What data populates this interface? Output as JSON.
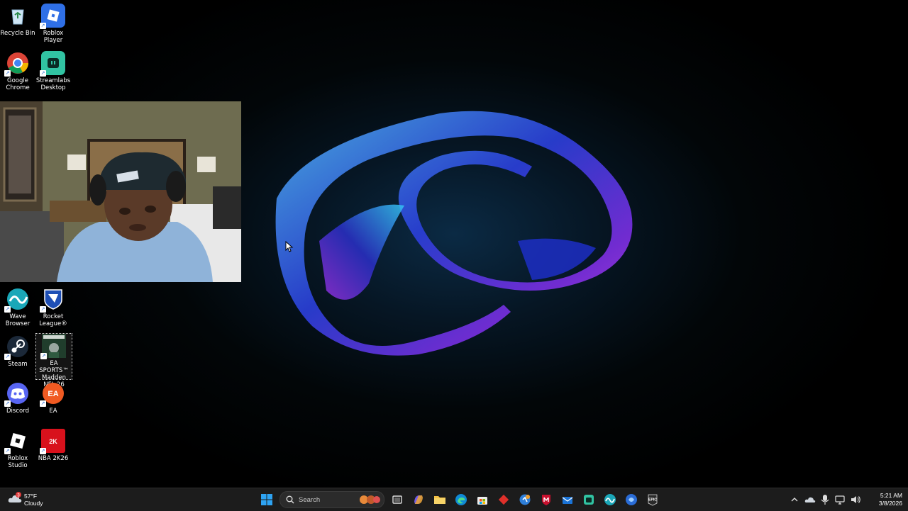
{
  "desktop": {
    "icons": [
      {
        "label": "Recycle Bin",
        "icon": "recycle-bin-icon"
      },
      {
        "label": "Roblox Player",
        "icon": "roblox-icon"
      },
      {
        "label": "Google Chrome",
        "icon": "chrome-icon"
      },
      {
        "label": "Streamlabs Desktop",
        "icon": "streamlabs-icon"
      },
      {
        "label": "Wave Browser",
        "icon": "wave-browser-icon"
      },
      {
        "label": "Rocket League®",
        "icon": "rocket-league-icon"
      },
      {
        "label": "Steam",
        "icon": "steam-icon"
      },
      {
        "label": "EA SPORTS™ Madden NFL 26",
        "icon": "madden-icon"
      },
      {
        "label": "Discord",
        "icon": "discord-icon"
      },
      {
        "label": "EA",
        "icon": "ea-icon"
      },
      {
        "label": "Roblox Studio",
        "icon": "roblox-studio-icon"
      },
      {
        "label": "NBA 2K26",
        "icon": "nba2k-icon"
      }
    ]
  },
  "webcam": {
    "label": "webcam-overlay"
  },
  "taskbar": {
    "weather": {
      "temperature": "57°F",
      "condition": "Cloudy",
      "badge": "3"
    },
    "search": {
      "placeholder": "Search"
    },
    "pinned": [
      "file-explorer",
      "copilot",
      "folder",
      "edge",
      "store",
      "app-red",
      "app-blue",
      "mcafee",
      "mail",
      "streamlabs",
      "wave",
      "app-circle",
      "epic-games"
    ],
    "epic_label": "EPIC",
    "clock": {
      "time": "5:21 AM",
      "date": "3/8/2026"
    }
  },
  "colors": {
    "taskbar": "#1c1c1c",
    "accent": "#0078d4"
  }
}
